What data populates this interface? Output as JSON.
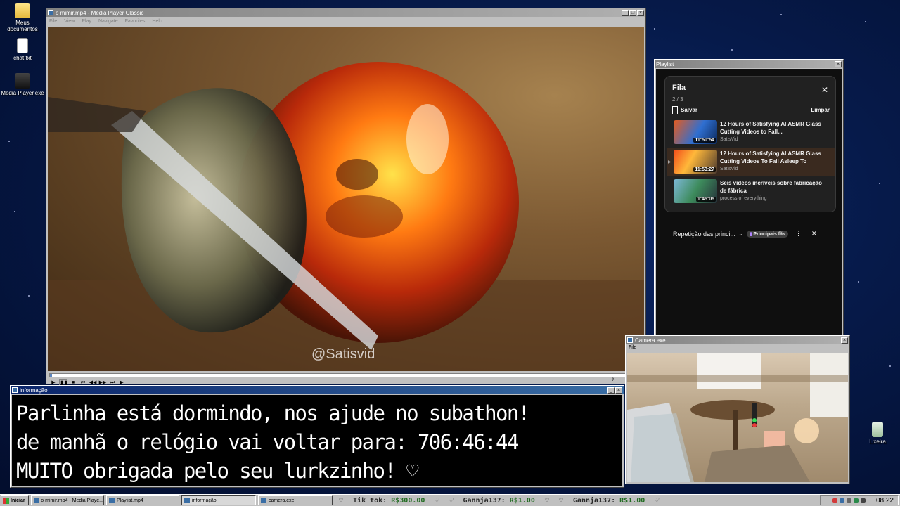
{
  "desktop": {
    "icons": [
      {
        "label": "Meus documentos"
      },
      {
        "label": "chat.txt"
      },
      {
        "label": "Media Player.exe"
      },
      {
        "label": "Lixeira"
      }
    ]
  },
  "media_player": {
    "title": "o mimir.mp4 - Media Player Classic",
    "menu": [
      "File",
      "View",
      "Play",
      "Navigate",
      "Favorites",
      "Help"
    ],
    "watermark": "@Satisvid",
    "progress": 0.003
  },
  "playlist_window": {
    "title": "Playlist",
    "queue": {
      "heading": "Fila",
      "count": "2 / 3",
      "save_label": "Salvar",
      "clear_label": "Limpar",
      "items": [
        {
          "title": "12 Hours of Satisfying AI ASMR Glass Cutting Videos to Fall...",
          "duration": "11:50:54",
          "channel": "SatisVid",
          "current": false
        },
        {
          "title": "12 Hours of Satisfying AI ASMR Glass Cutting Videos To Fall Asleep To",
          "duration": "11:53:27",
          "channel": "SatisVid",
          "current": true
        },
        {
          "title": "Seis vídeos incríveis sobre fabricação de fábrica",
          "duration": "1:45:05",
          "channel": "process of everything",
          "current": false
        }
      ]
    },
    "mix": {
      "label": "Repetição das princi...",
      "badge": "Principais fãs"
    }
  },
  "info_window": {
    "title": "informação",
    "lines": [
      "Parlinha está dormindo, nos ajude no subathon!",
      "de manhã o relógio vai voltar para:  706:46:44",
      "MUITO obrigada pelo seu lurkzinho! ♡"
    ]
  },
  "camera_window": {
    "title": "Camera.exe",
    "menu": "File"
  },
  "taskbar": {
    "start_label": "Iniciar",
    "tasks": [
      {
        "label": "o mimir.mp4 - Media Playe..."
      },
      {
        "label": "Playlist.mp4"
      },
      {
        "label": "informação"
      },
      {
        "label": "camera.exe"
      }
    ],
    "ticker": [
      {
        "name": "Tik tok:",
        "amount": "R$300.00"
      },
      {
        "name": "Gannja137:",
        "amount": "R$1.00"
      },
      {
        "name": "Gannja137:",
        "amount": "R$1.00"
      }
    ],
    "clock": "08:22"
  }
}
